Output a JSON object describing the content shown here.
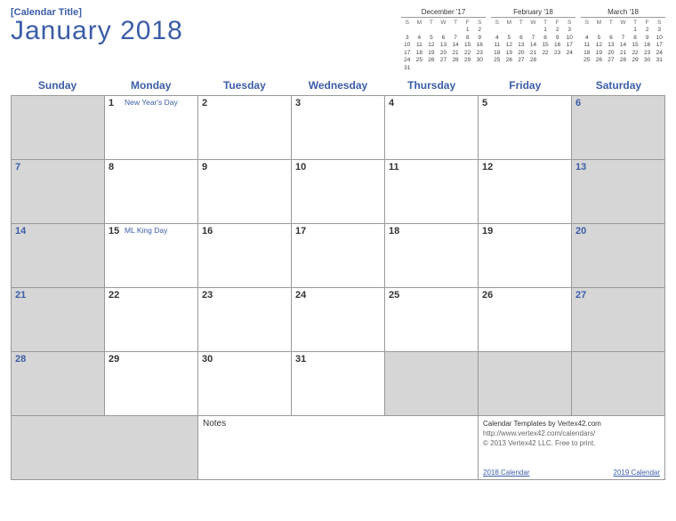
{
  "header": {
    "title_placeholder": "[Calendar Title]",
    "month_year": "January  2018"
  },
  "mini_calendars": [
    {
      "title": "December '17",
      "dow": [
        "S",
        "M",
        "T",
        "W",
        "T",
        "F",
        "S"
      ],
      "rows": [
        [
          "",
          "",
          "",
          "",
          "",
          "1",
          "2"
        ],
        [
          "3",
          "4",
          "5",
          "6",
          "7",
          "8",
          "9"
        ],
        [
          "10",
          "11",
          "12",
          "13",
          "14",
          "15",
          "16"
        ],
        [
          "17",
          "18",
          "19",
          "20",
          "21",
          "22",
          "23"
        ],
        [
          "24",
          "25",
          "26",
          "27",
          "28",
          "29",
          "30"
        ],
        [
          "31",
          "",
          "",
          "",
          "",
          "",
          ""
        ]
      ]
    },
    {
      "title": "February '18",
      "dow": [
        "S",
        "M",
        "T",
        "W",
        "T",
        "F",
        "S"
      ],
      "rows": [
        [
          "",
          "",
          "",
          "",
          "1",
          "2",
          "3"
        ],
        [
          "4",
          "5",
          "6",
          "7",
          "8",
          "9",
          "10"
        ],
        [
          "11",
          "12",
          "13",
          "14",
          "15",
          "16",
          "17"
        ],
        [
          "18",
          "19",
          "20",
          "21",
          "22",
          "23",
          "24"
        ],
        [
          "25",
          "26",
          "27",
          "28",
          "",
          "",
          ""
        ]
      ]
    },
    {
      "title": "March '18",
      "dow": [
        "S",
        "M",
        "T",
        "W",
        "T",
        "F",
        "S"
      ],
      "rows": [
        [
          "",
          "",
          "",
          "",
          "1",
          "2",
          "3"
        ],
        [
          "4",
          "5",
          "6",
          "7",
          "8",
          "9",
          "10"
        ],
        [
          "11",
          "12",
          "13",
          "14",
          "15",
          "16",
          "17"
        ],
        [
          "18",
          "19",
          "20",
          "21",
          "22",
          "23",
          "24"
        ],
        [
          "25",
          "26",
          "27",
          "28",
          "29",
          "30",
          "31"
        ]
      ]
    }
  ],
  "dow_headers": [
    "Sunday",
    "Monday",
    "Tuesday",
    "Wednesday",
    "Thursday",
    "Friday",
    "Saturday"
  ],
  "cells": [
    {
      "day": "",
      "grey": true,
      "weekend": true
    },
    {
      "day": "1",
      "event": "New Year's Day"
    },
    {
      "day": "2"
    },
    {
      "day": "3"
    },
    {
      "day": "4"
    },
    {
      "day": "5"
    },
    {
      "day": "6",
      "grey": true,
      "weekend": true
    },
    {
      "day": "7",
      "grey": true,
      "weekend": true
    },
    {
      "day": "8"
    },
    {
      "day": "9"
    },
    {
      "day": "10"
    },
    {
      "day": "11"
    },
    {
      "day": "12"
    },
    {
      "day": "13",
      "grey": true,
      "weekend": true
    },
    {
      "day": "14",
      "grey": true,
      "weekend": true
    },
    {
      "day": "15",
      "event": "ML King Day"
    },
    {
      "day": "16"
    },
    {
      "day": "17"
    },
    {
      "day": "18"
    },
    {
      "day": "19"
    },
    {
      "day": "20",
      "grey": true,
      "weekend": true
    },
    {
      "day": "21",
      "grey": true,
      "weekend": true
    },
    {
      "day": "22"
    },
    {
      "day": "23"
    },
    {
      "day": "24"
    },
    {
      "day": "25"
    },
    {
      "day": "26"
    },
    {
      "day": "27",
      "grey": true,
      "weekend": true
    },
    {
      "day": "28",
      "grey": true,
      "weekend": true
    },
    {
      "day": "29"
    },
    {
      "day": "30"
    },
    {
      "day": "31"
    },
    {
      "day": "",
      "grey": true
    },
    {
      "day": "",
      "grey": true
    },
    {
      "day": "",
      "grey": true
    }
  ],
  "notes_label": "Notes",
  "credits": {
    "line1": "Calendar Templates by Vertex42.com",
    "line2": "http://www.vertex42.com/calendars/",
    "line3": "© 2013 Vertex42 LLC. Free to print."
  },
  "footer_links": {
    "left": "2018 Calendar",
    "right": "2019 Calendar"
  }
}
